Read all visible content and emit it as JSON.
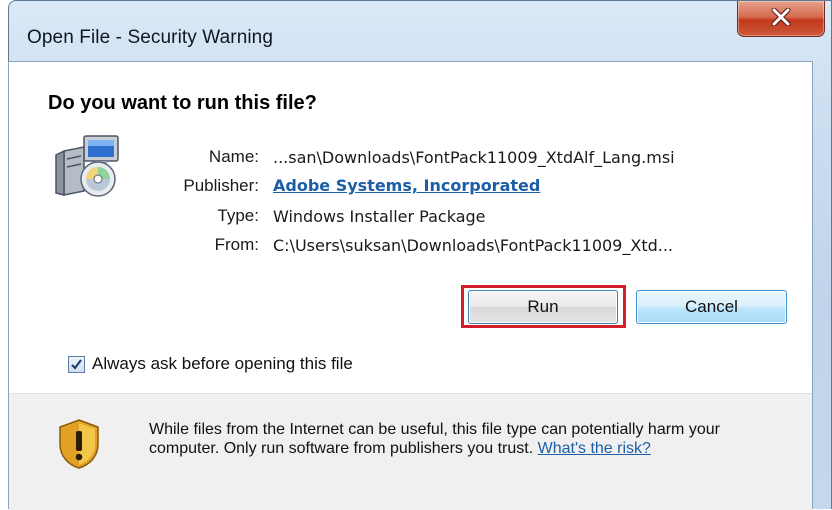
{
  "window": {
    "title": "Open File - Security Warning"
  },
  "dialog": {
    "heading": "Do you want to run this file?",
    "fields": [
      {
        "label": "Name:",
        "value": "...san\\Downloads\\FontPack11009_XtdAlf_Lang.msi",
        "link": false
      },
      {
        "label": "Publisher:",
        "value": "Adobe Systems, Incorporated",
        "link": true
      },
      {
        "label": "Type:",
        "value": "Windows Installer Package",
        "link": false
      },
      {
        "label": "From:",
        "value": "C:\\Users\\suksan\\Downloads\\FontPack11009_Xtd...",
        "link": false
      }
    ],
    "buttons": {
      "run": "Run",
      "cancel": "Cancel"
    },
    "checkbox": {
      "label": "Always ask before opening this file",
      "checked": true
    },
    "warning": {
      "text": "While files from the Internet can be useful, this file type can potentially harm your computer. Only run software from publishers you trust.",
      "link": "What's the risk?"
    }
  },
  "colors": {
    "highlight": "#d31f2b",
    "link": "#1c5fa8",
    "close_button": "#c1391d"
  },
  "icons": {
    "title_close": "close-icon",
    "file_type": "installer-package-icon",
    "warning": "security-shield-icon",
    "checkbox": "checkmark-icon"
  }
}
